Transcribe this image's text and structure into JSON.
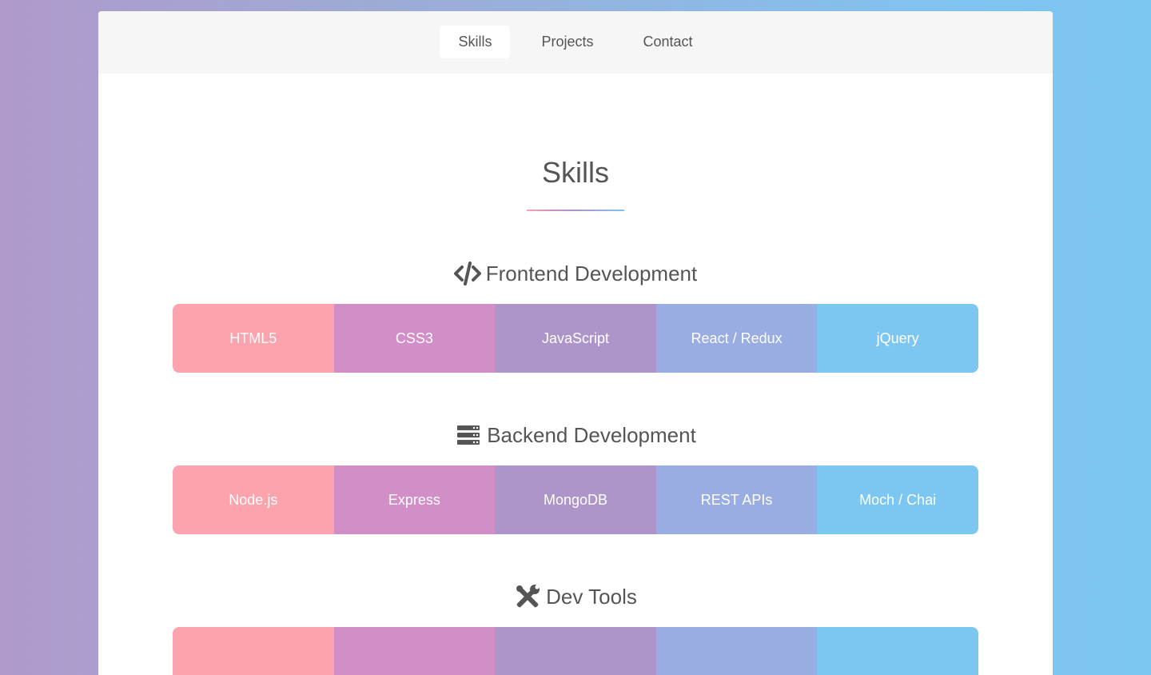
{
  "nav": {
    "tabs": [
      {
        "label": "Skills",
        "active": true
      },
      {
        "label": "Projects",
        "active": false
      },
      {
        "label": "Contact",
        "active": false
      }
    ]
  },
  "page": {
    "title": "Skills"
  },
  "colors": {
    "tile_1": "#fda3ad",
    "tile_2": "#d18ec7",
    "tile_3": "#ad95c9",
    "tile_4": "#99ade2",
    "tile_5": "#7cc7f2",
    "text": "#555555",
    "navbar_bg": "#f6f6f6"
  },
  "sections": [
    {
      "icon": "code-icon",
      "heading": "Frontend Development",
      "skills": [
        "HTML5",
        "CSS3",
        "JavaScript",
        "React / Redux",
        "jQuery"
      ]
    },
    {
      "icon": "server-icon",
      "heading": "Backend Development",
      "skills": [
        "Node.js",
        "Express",
        "MongoDB",
        "REST APIs",
        "Moch / Chai"
      ]
    },
    {
      "icon": "tools-icon",
      "heading": "Dev Tools",
      "skills": [
        "",
        "",
        "",
        "",
        ""
      ]
    }
  ]
}
